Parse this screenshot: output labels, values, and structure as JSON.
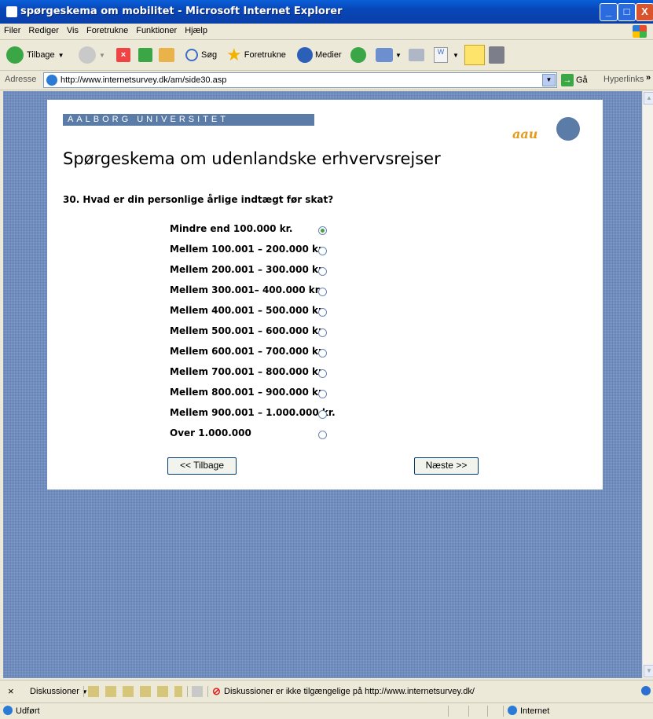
{
  "window": {
    "title": "spørgeskema om mobilitet - Microsoft Internet Explorer",
    "buttons": [
      "_",
      "□",
      "X"
    ]
  },
  "menu": [
    "Filer",
    "Rediger",
    "Vis",
    "Foretrukne",
    "Funktioner",
    "Hjælp"
  ],
  "toolbar": {
    "back": "Tilbage",
    "search": "Søg",
    "favorites": "Foretrukne",
    "media": "Medier"
  },
  "address": {
    "label": "Adresse",
    "url": "http://www.internetsurvey.dk/am/side30.asp",
    "go": "Gå",
    "links": "Hyperlinks"
  },
  "page": {
    "university_banner": "AALBORG UNIVERSITET",
    "logo_text": "aau",
    "heading": "Spørgeskema om udenlandske erhvervsrejser",
    "question": "30. Hvad er din personlige årlige indtægt før skat?",
    "options": [
      {
        "label": "Mindre end 100.000 kr.",
        "selected": true
      },
      {
        "label": "Mellem 100.001 – 200.000 kr.",
        "selected": false
      },
      {
        "label": "Mellem 200.001 – 300.000 kr.",
        "selected": false
      },
      {
        "label": "Mellem 300.001– 400.000 kr.",
        "selected": false
      },
      {
        "label": "Mellem 400.001 – 500.000 kr.",
        "selected": false
      },
      {
        "label": "Mellem 500.001 – 600.000 kr.",
        "selected": false
      },
      {
        "label": "Mellem 600.001 – 700.000 kr.",
        "selected": false
      },
      {
        "label": "Mellem 700.001 – 800.000 kr.",
        "selected": false
      },
      {
        "label": "Mellem 800.001 – 900.000 kr.",
        "selected": false
      },
      {
        "label": "Mellem 900.001 – 1.000.000 kr.",
        "selected": false
      },
      {
        "label": "Over 1.000.000",
        "selected": false
      }
    ],
    "back_button": "<< Tilbage",
    "next_button": "Næste >>"
  },
  "discussion_bar": {
    "close": "×",
    "label": "Diskussioner",
    "message": "Diskussioner er ikke tilgængelige på http://www.internetsurvey.dk/"
  },
  "status": {
    "text": "Udført",
    "zone": "Internet"
  },
  "colors": {
    "title_blue": "#0A5FD8",
    "page_bg": "#5E7EB6",
    "aau_blue": "#5C7CA8",
    "aau_orange": "#E79A1A"
  }
}
